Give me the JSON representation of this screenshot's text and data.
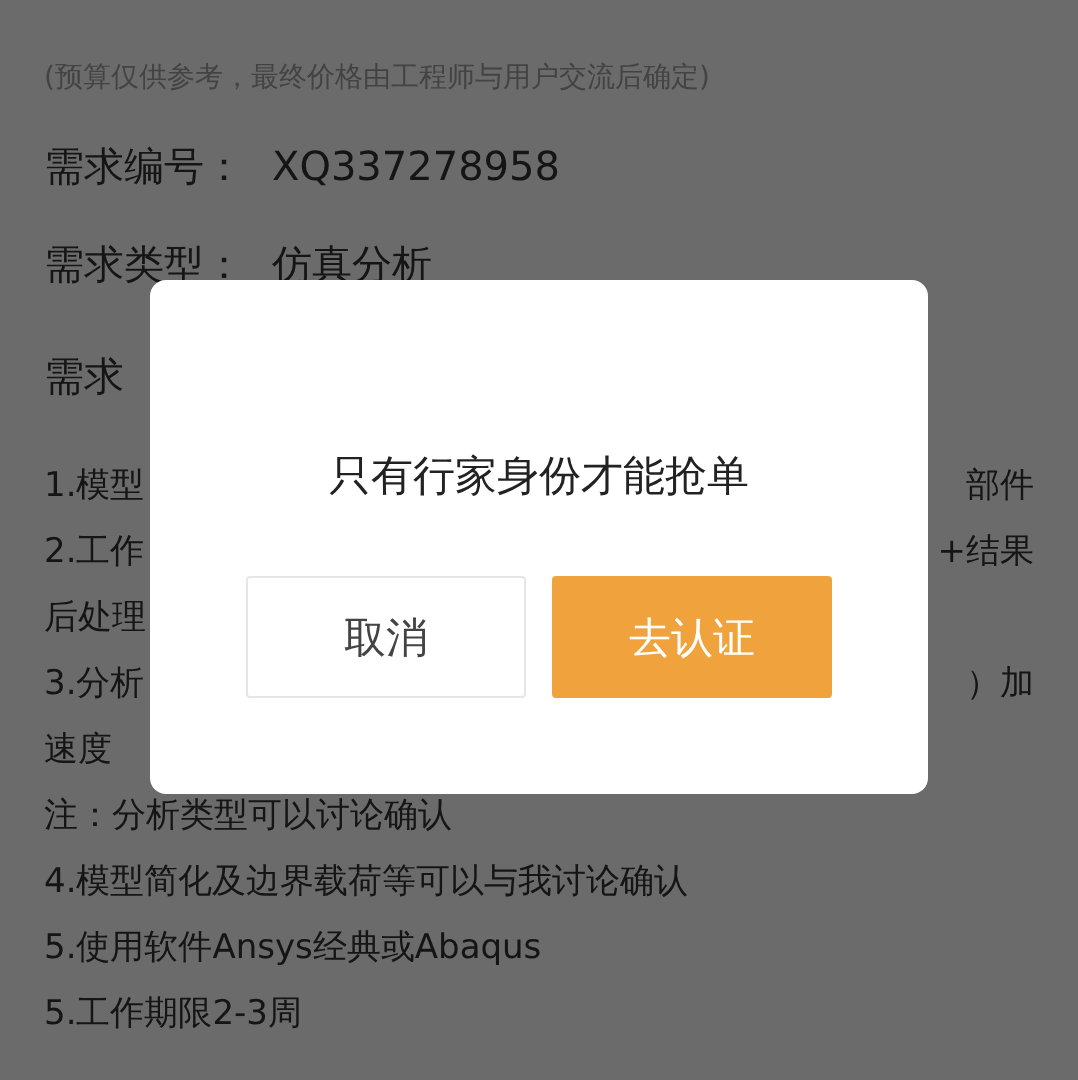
{
  "page": {
    "budget_note": "(预算仅供参考，最终价格由工程师与用户交流后确定)",
    "fields": [
      {
        "label": "需求编号：",
        "value": "XQ337278958"
      },
      {
        "label": "需求类型：",
        "value": "仿真分析"
      }
    ],
    "description_heading": "需求",
    "description_lines": [
      {
        "left": "1.模型",
        "right": "部件"
      },
      {
        "left": "2.工作",
        "right": "+结果"
      },
      {
        "left": "后处理"
      },
      {
        "left": "3.分析",
        "right": "）加"
      },
      {
        "left": "速度"
      },
      {
        "left": "注：分析类型可以讨论确认"
      },
      {
        "left": "4.模型简化及边界载荷等可以与我讨论确认"
      },
      {
        "left": "5.使用软件Ansys经典或Abaqus"
      },
      {
        "left": "5.工作期限2-3周"
      }
    ]
  },
  "dialog": {
    "message": "只有行家身份才能抢单",
    "buttons": [
      {
        "label": "取消",
        "kind": "secondary"
      },
      {
        "label": "去认证",
        "kind": "primary"
      }
    ]
  }
}
